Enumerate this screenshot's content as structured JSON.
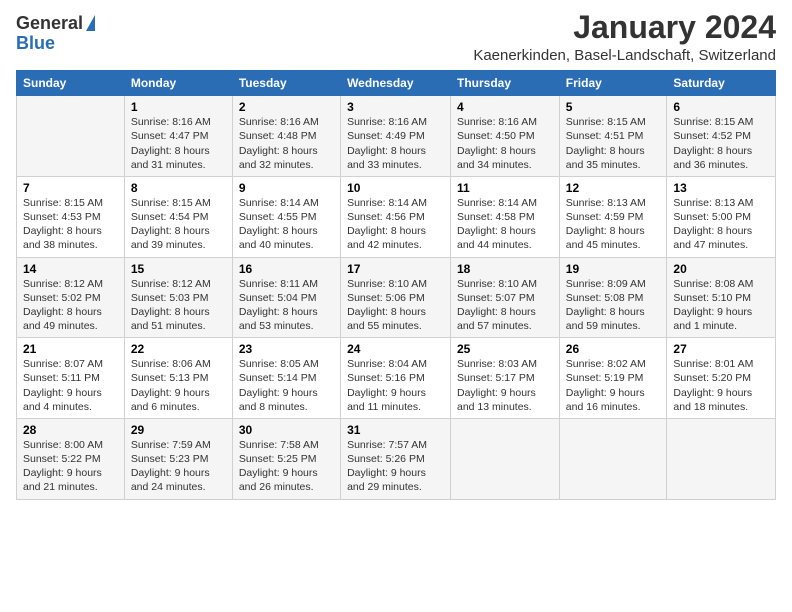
{
  "logo": {
    "general": "General",
    "blue": "Blue"
  },
  "title": "January 2024",
  "subtitle": "Kaenerkinden, Basel-Landschaft, Switzerland",
  "days_of_week": [
    "Sunday",
    "Monday",
    "Tuesday",
    "Wednesday",
    "Thursday",
    "Friday",
    "Saturday"
  ],
  "weeks": [
    [
      {
        "day": "",
        "content": ""
      },
      {
        "day": "1",
        "content": "Sunrise: 8:16 AM\nSunset: 4:47 PM\nDaylight: 8 hours\nand 31 minutes."
      },
      {
        "day": "2",
        "content": "Sunrise: 8:16 AM\nSunset: 4:48 PM\nDaylight: 8 hours\nand 32 minutes."
      },
      {
        "day": "3",
        "content": "Sunrise: 8:16 AM\nSunset: 4:49 PM\nDaylight: 8 hours\nand 33 minutes."
      },
      {
        "day": "4",
        "content": "Sunrise: 8:16 AM\nSunset: 4:50 PM\nDaylight: 8 hours\nand 34 minutes."
      },
      {
        "day": "5",
        "content": "Sunrise: 8:15 AM\nSunset: 4:51 PM\nDaylight: 8 hours\nand 35 minutes."
      },
      {
        "day": "6",
        "content": "Sunrise: 8:15 AM\nSunset: 4:52 PM\nDaylight: 8 hours\nand 36 minutes."
      }
    ],
    [
      {
        "day": "7",
        "content": "Sunrise: 8:15 AM\nSunset: 4:53 PM\nDaylight: 8 hours\nand 38 minutes."
      },
      {
        "day": "8",
        "content": "Sunrise: 8:15 AM\nSunset: 4:54 PM\nDaylight: 8 hours\nand 39 minutes."
      },
      {
        "day": "9",
        "content": "Sunrise: 8:14 AM\nSunset: 4:55 PM\nDaylight: 8 hours\nand 40 minutes."
      },
      {
        "day": "10",
        "content": "Sunrise: 8:14 AM\nSunset: 4:56 PM\nDaylight: 8 hours\nand 42 minutes."
      },
      {
        "day": "11",
        "content": "Sunrise: 8:14 AM\nSunset: 4:58 PM\nDaylight: 8 hours\nand 44 minutes."
      },
      {
        "day": "12",
        "content": "Sunrise: 8:13 AM\nSunset: 4:59 PM\nDaylight: 8 hours\nand 45 minutes."
      },
      {
        "day": "13",
        "content": "Sunrise: 8:13 AM\nSunset: 5:00 PM\nDaylight: 8 hours\nand 47 minutes."
      }
    ],
    [
      {
        "day": "14",
        "content": "Sunrise: 8:12 AM\nSunset: 5:02 PM\nDaylight: 8 hours\nand 49 minutes."
      },
      {
        "day": "15",
        "content": "Sunrise: 8:12 AM\nSunset: 5:03 PM\nDaylight: 8 hours\nand 51 minutes."
      },
      {
        "day": "16",
        "content": "Sunrise: 8:11 AM\nSunset: 5:04 PM\nDaylight: 8 hours\nand 53 minutes."
      },
      {
        "day": "17",
        "content": "Sunrise: 8:10 AM\nSunset: 5:06 PM\nDaylight: 8 hours\nand 55 minutes."
      },
      {
        "day": "18",
        "content": "Sunrise: 8:10 AM\nSunset: 5:07 PM\nDaylight: 8 hours\nand 57 minutes."
      },
      {
        "day": "19",
        "content": "Sunrise: 8:09 AM\nSunset: 5:08 PM\nDaylight: 8 hours\nand 59 minutes."
      },
      {
        "day": "20",
        "content": "Sunrise: 8:08 AM\nSunset: 5:10 PM\nDaylight: 9 hours\nand 1 minute."
      }
    ],
    [
      {
        "day": "21",
        "content": "Sunrise: 8:07 AM\nSunset: 5:11 PM\nDaylight: 9 hours\nand 4 minutes."
      },
      {
        "day": "22",
        "content": "Sunrise: 8:06 AM\nSunset: 5:13 PM\nDaylight: 9 hours\nand 6 minutes."
      },
      {
        "day": "23",
        "content": "Sunrise: 8:05 AM\nSunset: 5:14 PM\nDaylight: 9 hours\nand 8 minutes."
      },
      {
        "day": "24",
        "content": "Sunrise: 8:04 AM\nSunset: 5:16 PM\nDaylight: 9 hours\nand 11 minutes."
      },
      {
        "day": "25",
        "content": "Sunrise: 8:03 AM\nSunset: 5:17 PM\nDaylight: 9 hours\nand 13 minutes."
      },
      {
        "day": "26",
        "content": "Sunrise: 8:02 AM\nSunset: 5:19 PM\nDaylight: 9 hours\nand 16 minutes."
      },
      {
        "day": "27",
        "content": "Sunrise: 8:01 AM\nSunset: 5:20 PM\nDaylight: 9 hours\nand 18 minutes."
      }
    ],
    [
      {
        "day": "28",
        "content": "Sunrise: 8:00 AM\nSunset: 5:22 PM\nDaylight: 9 hours\nand 21 minutes."
      },
      {
        "day": "29",
        "content": "Sunrise: 7:59 AM\nSunset: 5:23 PM\nDaylight: 9 hours\nand 24 minutes."
      },
      {
        "day": "30",
        "content": "Sunrise: 7:58 AM\nSunset: 5:25 PM\nDaylight: 9 hours\nand 26 minutes."
      },
      {
        "day": "31",
        "content": "Sunrise: 7:57 AM\nSunset: 5:26 PM\nDaylight: 9 hours\nand 29 minutes."
      },
      {
        "day": "",
        "content": ""
      },
      {
        "day": "",
        "content": ""
      },
      {
        "day": "",
        "content": ""
      }
    ]
  ]
}
